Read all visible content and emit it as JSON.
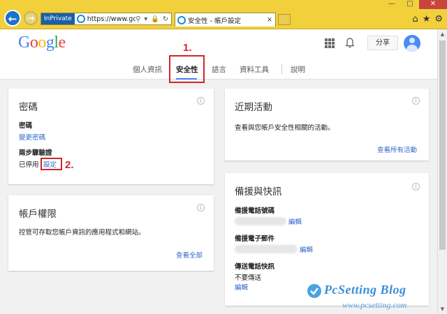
{
  "browser": {
    "inprivate_label": "InPrivate",
    "address_text": "https://www.goog...",
    "address_tools": "⚲ ▾ 🔒 ↻",
    "tab_title": "安全性 - 帳戶設定",
    "tab_close": "×",
    "win_minimize": "—",
    "win_maximize": "□",
    "win_close": "✕",
    "back_icon": "arrow-left-icon",
    "forward_icon": "arrow-right-icon"
  },
  "header": {
    "logo_letters": [
      "G",
      "o",
      "o",
      "g",
      "l",
      "e"
    ],
    "share_label": "分享",
    "nav": [
      "個人資訊",
      "安全性",
      "語言",
      "資料工具",
      "說明"
    ],
    "active_nav": "安全性"
  },
  "annotations": {
    "step1": "1.",
    "step2": "2.",
    "highlight_color": "#d0262b"
  },
  "password_card": {
    "title": "密碼",
    "password_label": "密碼",
    "change_password_link": "變更密碼",
    "two_step_label": "兩步驟驗證",
    "two_step_status": "已停用",
    "setup_link": "設定"
  },
  "permissions_card": {
    "title": "帳戶權限",
    "description": "控管可存取您帳戶資訊的應用程式和網站。",
    "view_all_link": "查看全部"
  },
  "recent_activity_card": {
    "title": "近期活動",
    "description": "查看與您帳戶安全性相關的活動。",
    "view_all_link": "查看所有活動"
  },
  "backup_card": {
    "title": "備援與快訊",
    "phone_label": "備援電話號碼",
    "phone_edit": "編輯",
    "email_label": "備援電子郵件",
    "email_edit": "編輯",
    "sms_label": "傳送電話快訊",
    "sms_value": "不要傳送",
    "sms_edit": "編輯"
  },
  "watermark": {
    "title": "PcSetting Blog",
    "url": "www.pcsetting.com"
  },
  "colors": {
    "chrome": "#f2d03b",
    "link": "#3366cc",
    "accent": "#4285f4"
  }
}
